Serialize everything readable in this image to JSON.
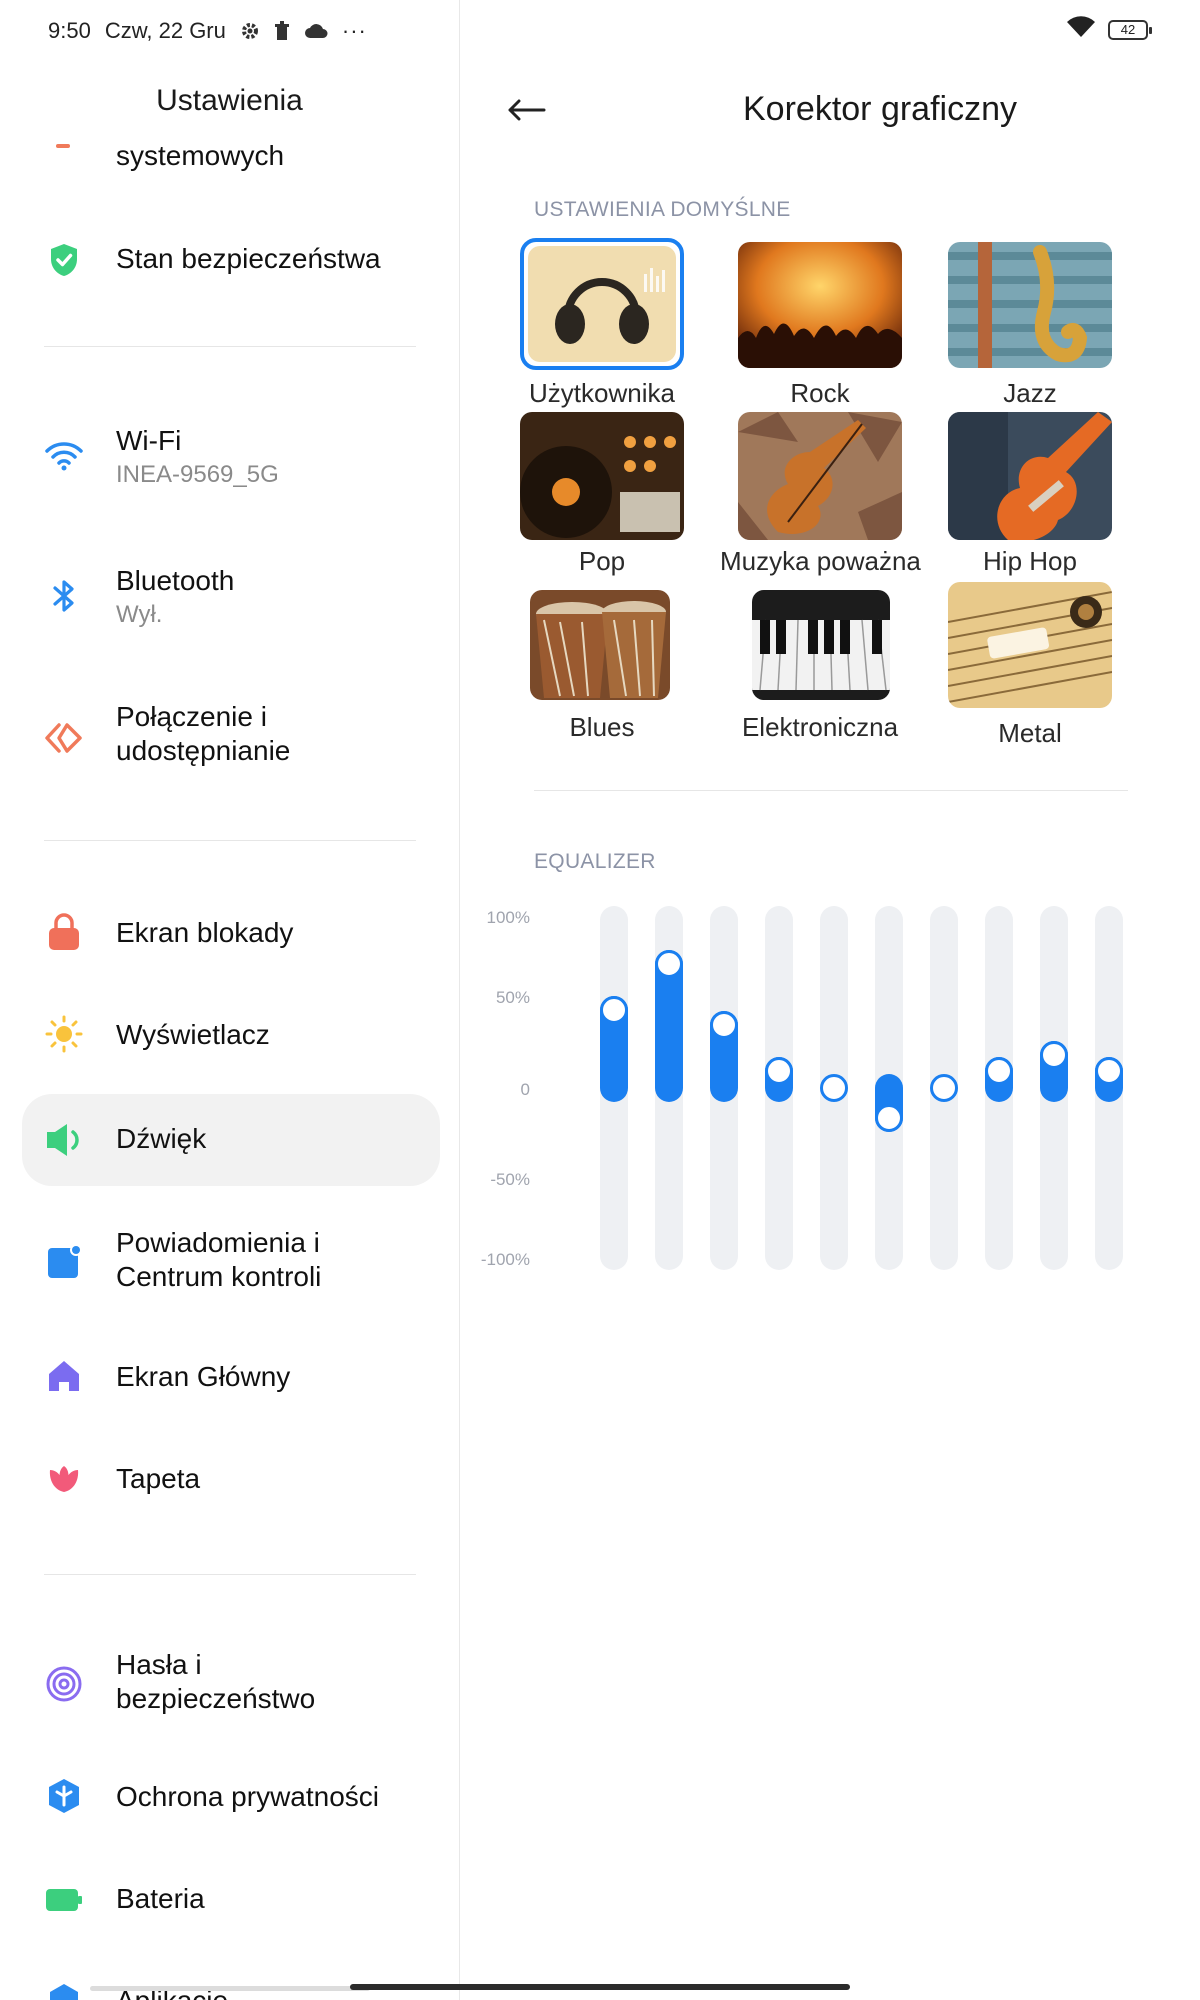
{
  "status_bar": {
    "time": "9:50",
    "date": "Czw, 22 Gru",
    "more": "···",
    "battery": "42"
  },
  "left_panel": {
    "title": "Ustawienia",
    "partial_item": "systemowych",
    "items": [
      {
        "label": "Stan bezpieczeństwa",
        "sub": "",
        "icon": "shield-check-icon"
      },
      {
        "label": "Wi-Fi",
        "sub": "INEA-9569_5G",
        "icon": "wifi-icon"
      },
      {
        "label": "Bluetooth",
        "sub": "Wył.",
        "icon": "bluetooth-icon"
      },
      {
        "label": "Połączenie i",
        "label2": "udostępnianie",
        "sub": "",
        "icon": "connection-share-icon"
      },
      {
        "label": "Ekran blokady",
        "sub": "",
        "icon": "lock-icon"
      },
      {
        "label": "Wyświetlacz",
        "sub": "",
        "icon": "sun-icon"
      },
      {
        "label": "Dźwięk",
        "sub": "",
        "icon": "speaker-icon"
      },
      {
        "label": "Powiadomienia i",
        "label2": "Centrum kontroli",
        "sub": "",
        "icon": "notification-icon"
      },
      {
        "label": "Ekran Główny",
        "sub": "",
        "icon": "home-icon"
      },
      {
        "label": "Tapeta",
        "sub": "",
        "icon": "flower-icon"
      },
      {
        "label": "Hasła i",
        "label2": "bezpieczeństwo",
        "sub": "",
        "icon": "fingerprint-icon"
      },
      {
        "label": "Ochrona prywatności",
        "sub": "",
        "icon": "privacy-icon"
      },
      {
        "label": "Bateria",
        "sub": "",
        "icon": "battery-icon"
      },
      {
        "label": "Aplikacje",
        "sub": "",
        "icon": "gear-icon"
      }
    ]
  },
  "right_panel": {
    "title": "Korektor graficzny",
    "presets_label": "USTAWIENIA DOMYŚLNE",
    "presets": [
      {
        "label": "Użytkownika",
        "selected": true
      },
      {
        "label": "Rock",
        "selected": false
      },
      {
        "label": "Jazz",
        "selected": false
      },
      {
        "label": "Pop",
        "selected": false
      },
      {
        "label": "Muzyka poważna",
        "selected": false
      },
      {
        "label": "Hip Hop",
        "selected": false
      },
      {
        "label": "Blues",
        "selected": false
      },
      {
        "label": "Elektroniczna",
        "selected": false
      },
      {
        "label": "Metal",
        "selected": false
      }
    ],
    "equalizer": {
      "label": "EQUALIZER",
      "axis_labels": [
        "100%",
        "50%",
        "0",
        "-50%",
        "-100%"
      ],
      "band_levels_percent": [
        47,
        75,
        38,
        10,
        0,
        -18,
        0,
        10,
        20,
        10
      ],
      "accent_color": "#1a7ff0",
      "track_color": "#eef0f3"
    }
  }
}
